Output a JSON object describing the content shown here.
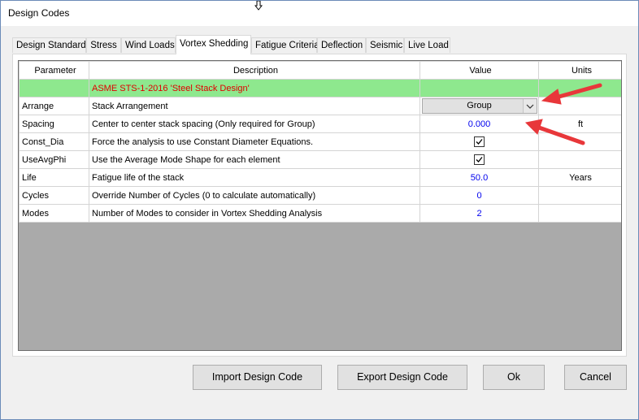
{
  "window": {
    "title": "Design Codes"
  },
  "tabs": [
    {
      "label": "Design Standard"
    },
    {
      "label": "Stress"
    },
    {
      "label": "Wind Loads"
    },
    {
      "label": "Vortex Shedding"
    },
    {
      "label": "Fatigue Criteria"
    },
    {
      "label": "Deflection"
    },
    {
      "label": "Seismic"
    },
    {
      "label": "Live Load"
    }
  ],
  "active_tab": "Vortex Shedding",
  "grid": {
    "headers": {
      "parameter": "Parameter",
      "description": "Description",
      "value": "Value",
      "units": "Units"
    },
    "banner": "ASME STS-1-2016 'Steel Stack Design'",
    "rows": [
      {
        "parameter": "Arrange",
        "description": "Stack Arrangement",
        "value": "Group",
        "units": ""
      },
      {
        "parameter": "Spacing",
        "description": "Center to center stack spacing (Only required for Group)",
        "value": "0.000",
        "units": "ft"
      },
      {
        "parameter": "Const_Dia",
        "description": "Force the analysis to use Constant Diameter Equations.",
        "value": "checked",
        "units": ""
      },
      {
        "parameter": "UseAvgPhi",
        "description": "Use the Average Mode Shape for each element",
        "value": "checked",
        "units": ""
      },
      {
        "parameter": "Life",
        "description": "Fatigue life of the stack",
        "value": "50.0",
        "units": "Years"
      },
      {
        "parameter": "Cycles",
        "description": "Override Number of Cycles (0 to calculate automatically)",
        "value": "0",
        "units": ""
      },
      {
        "parameter": "Modes",
        "description": "Number of Modes to consider in Vortex Shedding Analysis",
        "value": "2",
        "units": ""
      }
    ]
  },
  "buttons": {
    "import": "Import Design Code",
    "export": "Export Design Code",
    "ok": "Ok",
    "cancel": "Cancel"
  },
  "colors": {
    "banner_bg": "#8ee88e",
    "banner_text": "#e00000",
    "value_text": "#0000ee",
    "annotation_arrow": "#e8373a",
    "grid_empty": "#aaaaaa"
  }
}
